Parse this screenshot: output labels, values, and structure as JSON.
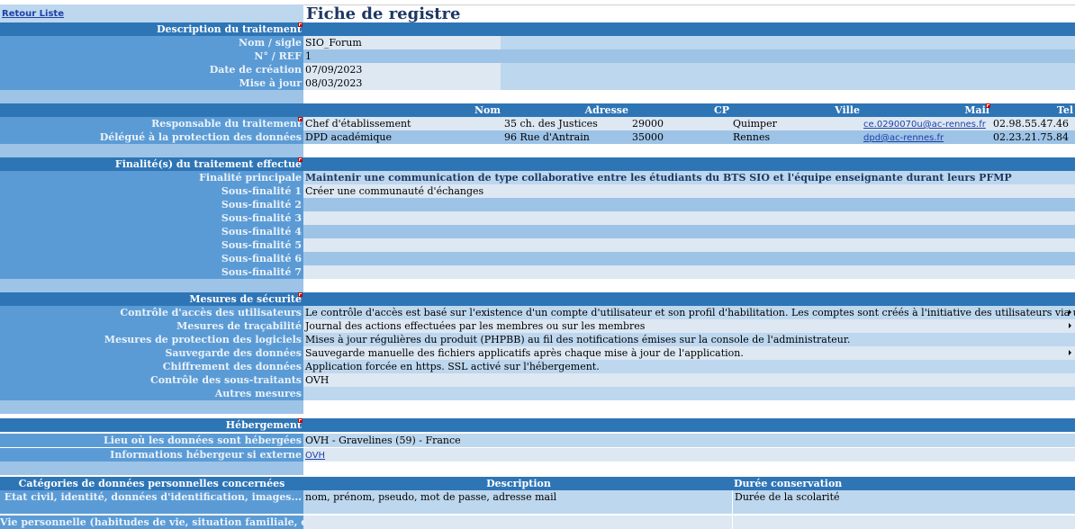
{
  "page": {
    "back_link": "Retour Liste",
    "title": "Fiche de registre"
  },
  "description": {
    "header": "Description  du traitement",
    "nom_label": "Nom / sigle",
    "nom_value": "SIO_Forum",
    "ref_label": "N° / REF",
    "ref_value": "1",
    "creation_label": "Date de création",
    "creation_value": "07/09/2023",
    "maj_label": "Mise à jour",
    "maj_value": "08/03/2023"
  },
  "contacts": {
    "columns": [
      "Nom",
      "Adresse",
      "CP",
      "Ville",
      "Mail",
      "Tel"
    ],
    "rows": [
      {
        "label": "Responsable du traitement",
        "nom": "Chef d'établissement",
        "adresse": "35 ch. des Justices",
        "cp": "29000",
        "ville": "Quimper",
        "mail": "ce.0290070u@ac-rennes.fr",
        "tel": "02.98.55.47.46"
      },
      {
        "label": "Délégué à la protection des données",
        "nom": "DPD académique",
        "adresse": "96 Rue d'Antrain",
        "cp": "35000",
        "ville": "Rennes",
        "mail": "dpd@ac-rennes.fr",
        "tel": "02.23.21.75.84"
      }
    ]
  },
  "finalites": {
    "header": "Finalité(s) du traitement effectué",
    "principale_label": "Finalité principale",
    "principale_value": "Maintenir une communication de type collaborative entre les étudiants du BTS SIO et l'équipe enseignante durant leurs PFMP",
    "sous": [
      {
        "label": "Sous-finalité 1",
        "value": "Créer une communauté d'échanges"
      },
      {
        "label": "Sous-finalité 2",
        "value": ""
      },
      {
        "label": "Sous-finalité 3",
        "value": ""
      },
      {
        "label": "Sous-finalité 4",
        "value": ""
      },
      {
        "label": "Sous-finalité 5",
        "value": ""
      },
      {
        "label": "Sous-finalité 6",
        "value": ""
      },
      {
        "label": "Sous-finalité 7",
        "value": ""
      }
    ]
  },
  "securite": {
    "header": "Mesures de sécurité",
    "items": [
      {
        "label": "Contrôle d'accès des utilisateurs",
        "value": "Le contrôle d'accès est basé sur l'existence d'un compte d'utilisateur et son profil d'habilitation. Les comptes sont créés à l'initiative des utilisateurs via une procédure"
      },
      {
        "label": "Mesures de traçabilité",
        "value": "Journal des actions effectuées par les membres ou sur les membres"
      },
      {
        "label": "Mesures de protection des logiciels",
        "value": "Mises à jour régulières du produit (PHPBB) au fil des notifications émises sur la console de l'administrateur."
      },
      {
        "label": "Sauvegarde des données",
        "value": "Sauvegarde manuelle des fichiers applicatifs après chaque mise à jour de l'application."
      },
      {
        "label": "Chiffrement des données",
        "value": "Application forcée en https. SSL activé sur l'hébergement."
      },
      {
        "label": "Contrôle des sous-traitants",
        "value": "OVH"
      },
      {
        "label": "Autres mesures",
        "value": ""
      }
    ]
  },
  "hebergement": {
    "header": "Hébergement",
    "lieu_label": "Lieu où les données sont hébergées",
    "lieu_value": "OVH - Gravelines (59) - France",
    "info_label": "Informations hébergeur si externe",
    "info_value": "OVH"
  },
  "categories": {
    "header": "Catégories de données personnelles concernées",
    "col_description": "Description",
    "col_duree": "Durée conservation",
    "rows": [
      {
        "label": "Etat civil, identité, données d'identification, images...",
        "description": "nom, prénom, pseudo, mot de passe, adresse mail",
        "duree": "Durée de la scolarité"
      },
      {
        "label": "Vie personnelle (habitudes de vie, situation familiale, etc.)",
        "description": "",
        "duree": ""
      }
    ]
  }
}
